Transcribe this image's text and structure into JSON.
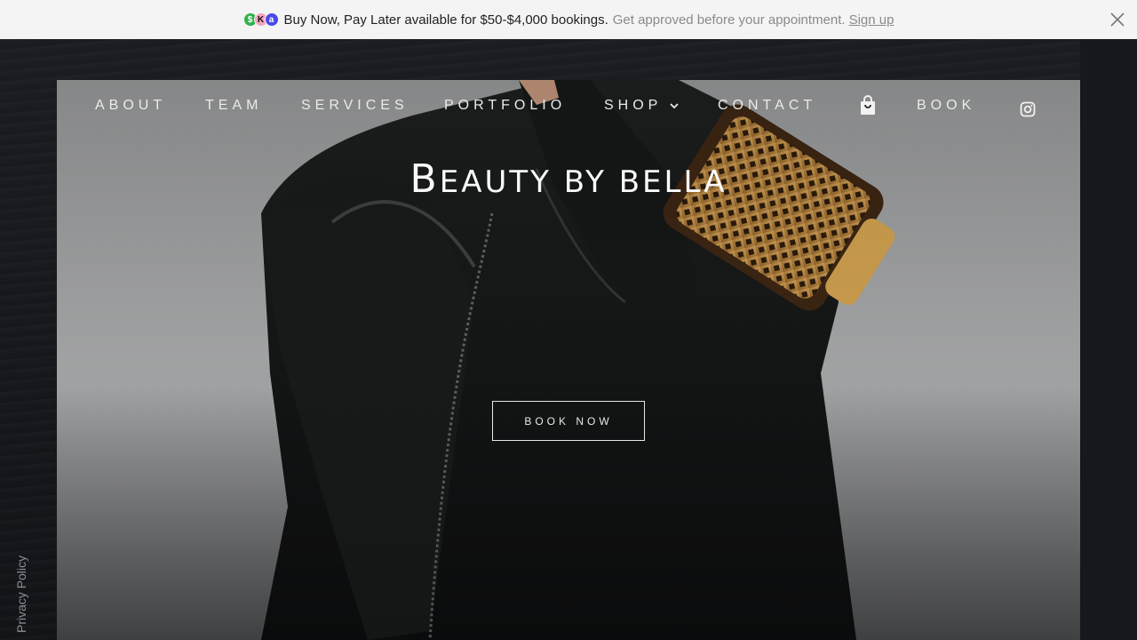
{
  "banner": {
    "logos": [
      {
        "name": "afterpay-logo-icon",
        "glyph": "$",
        "color": "#2fb34a"
      },
      {
        "name": "klarna-logo-icon",
        "glyph": "K",
        "color": "#f5a5c0"
      },
      {
        "name": "affirm-logo-icon",
        "glyph": "a",
        "color": "#4a4ae8"
      }
    ],
    "main_text": "Buy Now, Pay Later available for $50-$4,000 bookings.",
    "muted_text": "Get approved before your appointment.",
    "signup_label": "Sign up"
  },
  "nav": {
    "items": [
      {
        "label": "ABOUT"
      },
      {
        "label": "TEAM"
      },
      {
        "label": "SERVICES"
      },
      {
        "label": "PORTFOLIO"
      },
      {
        "label": "SHOP"
      },
      {
        "label": "CONTACT"
      },
      {
        "label": "BOOK"
      }
    ]
  },
  "site": {
    "title_first": "B",
    "title_rest": "EAUTY BY BELLA"
  },
  "hero": {
    "cta_label": "BOOK NOW"
  },
  "footer": {
    "privacy_label": "Privacy Policy"
  },
  "colors": {
    "banner_bg": "#f4f4f4",
    "page_bg": "#15171c",
    "text_light": "#eaeaea"
  }
}
